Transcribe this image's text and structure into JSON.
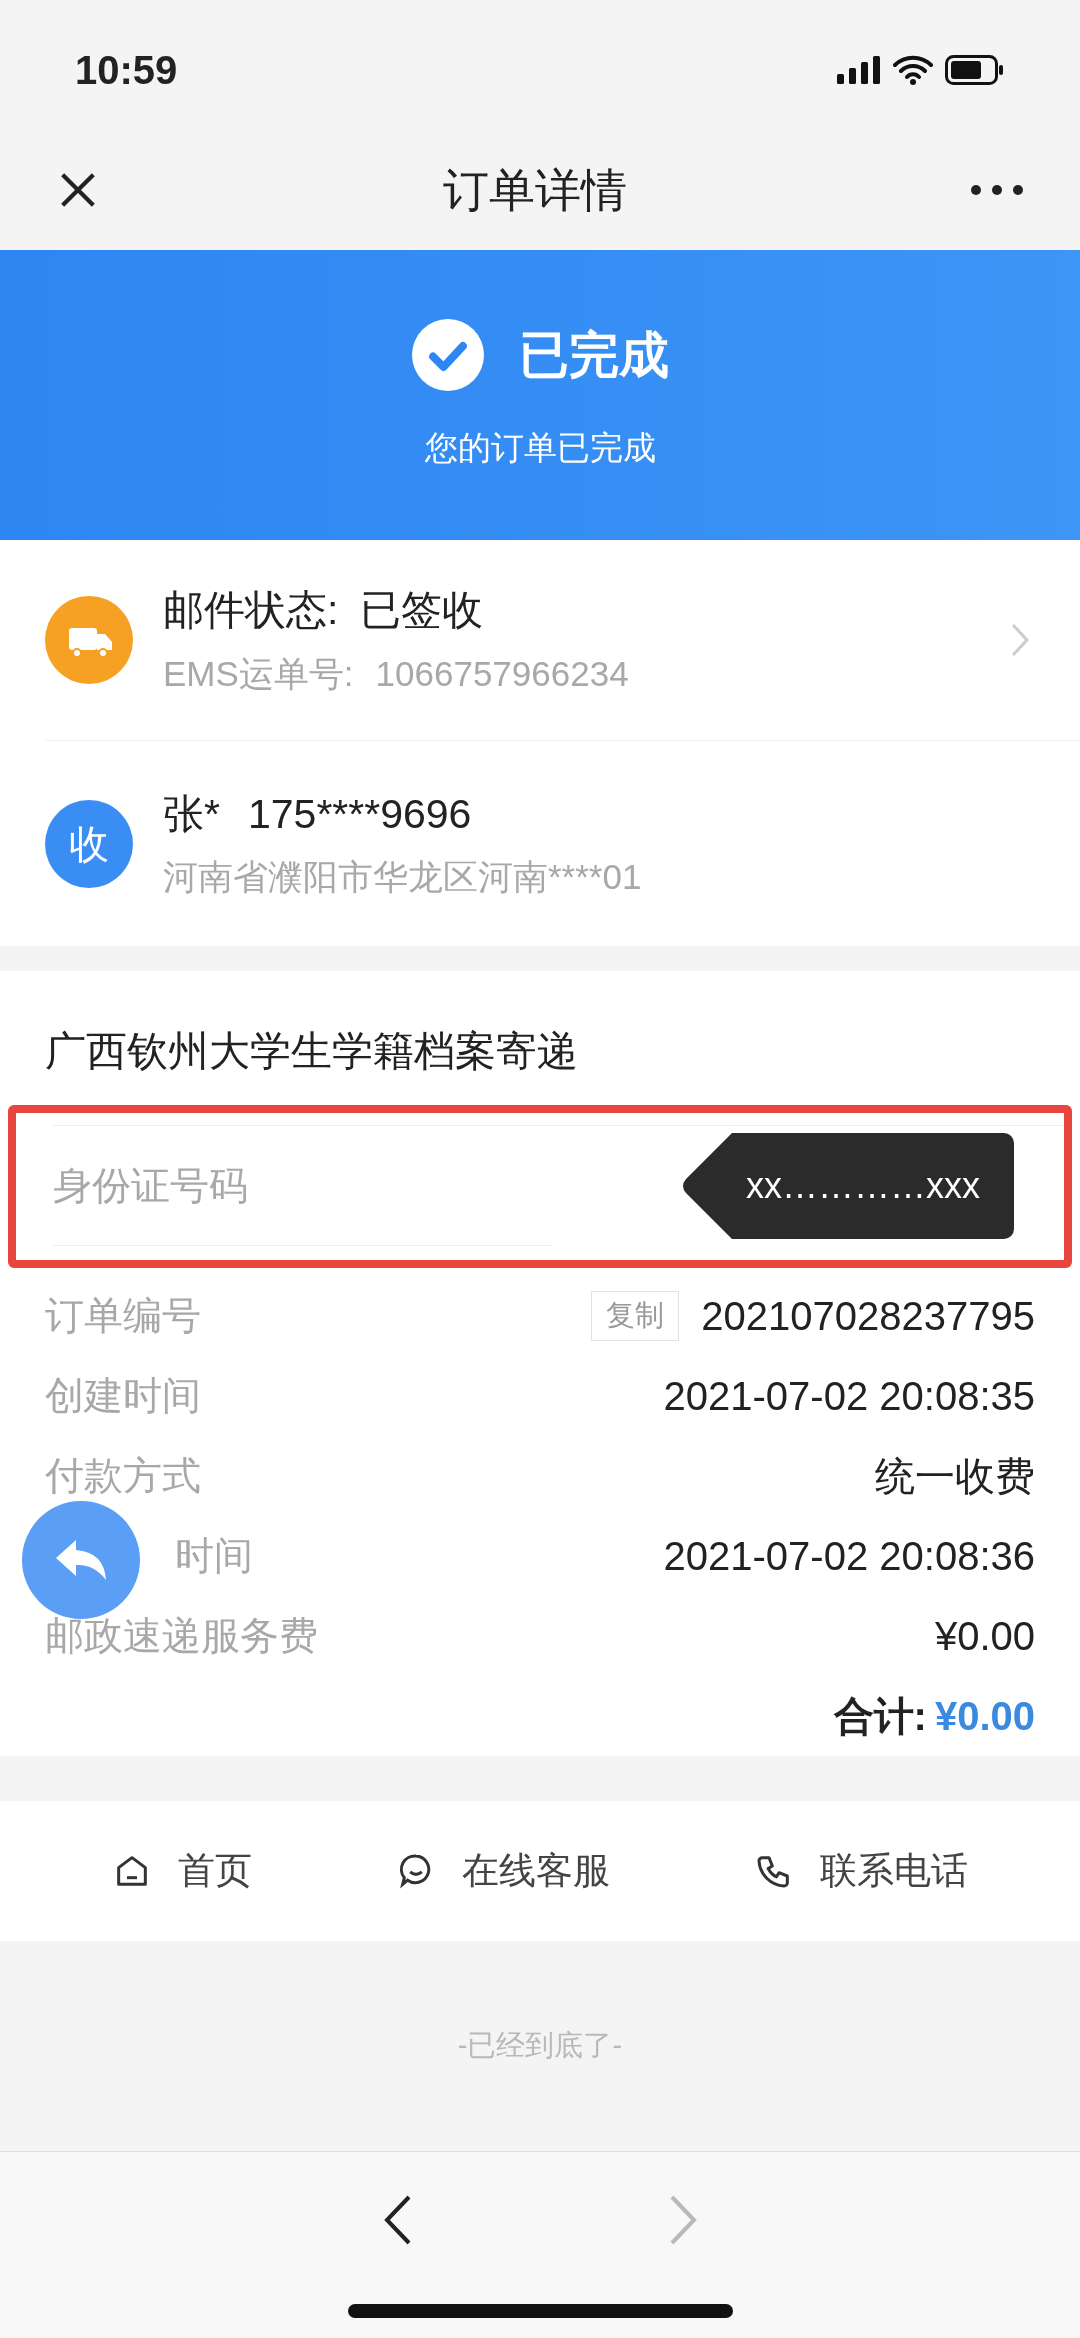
{
  "status_bar": {
    "time": "10:59"
  },
  "nav_bar": {
    "title": "订单详情"
  },
  "banner": {
    "title": "已完成",
    "subtitle": "您的订单已完成"
  },
  "shipment": {
    "status_label": "邮件状态:",
    "status_value": "已签收",
    "tracking_label": "EMS运单号:",
    "tracking_number": "1066757966234"
  },
  "recipient": {
    "badge": "收",
    "name": "张*",
    "phone": "175****9696",
    "address": "河南省濮阳市华龙区河南****01"
  },
  "order": {
    "title": "广西钦州大学生学籍档案寄递",
    "id_field": {
      "label": "身份证号码",
      "redaction_tag": "xx…………xxx"
    },
    "rows": [
      {
        "label": "订单编号",
        "value": "202107028237795",
        "copy_button": "复制"
      },
      {
        "label": "创建时间",
        "value": "2021-07-02 20:08:35"
      },
      {
        "label": "付款方式",
        "value": "统一收费"
      },
      {
        "label": "时间",
        "value": "2021-07-02 20:08:36"
      },
      {
        "label": "邮政速递服务费",
        "value": "¥0.00"
      }
    ],
    "total_label": "合计:",
    "total_value": "¥0.00"
  },
  "bottom_nav": [
    {
      "label": "首页",
      "kind": "home"
    },
    {
      "label": "在线客服",
      "kind": "chat"
    },
    {
      "label": "联系电话",
      "kind": "phone"
    }
  ],
  "footer": "-已经到底了-",
  "browser_bar": {
    "back_disabled": false,
    "forward_disabled": true
  }
}
